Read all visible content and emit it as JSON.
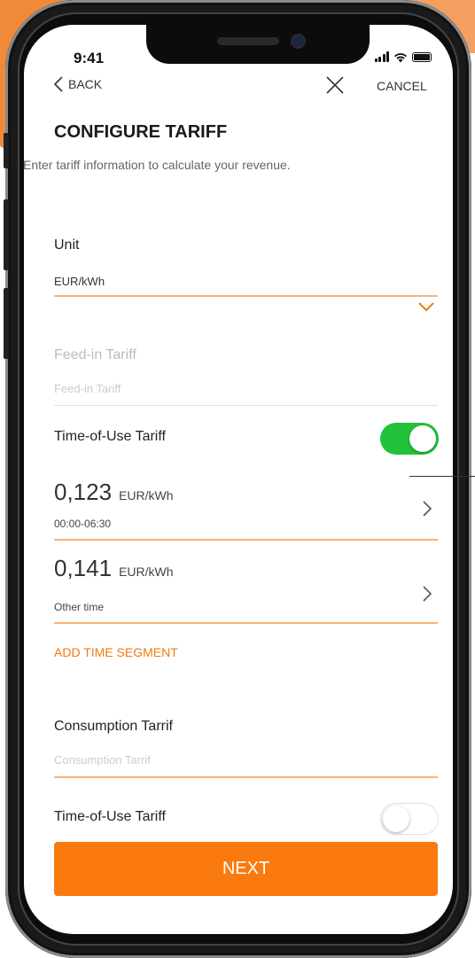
{
  "status_bar": {
    "time": "9:41"
  },
  "nav": {
    "back_label": "BACK",
    "cancel_label": "CANCEL"
  },
  "header": {
    "title": "CONFIGURE TARIFF",
    "subtitle": "Enter tariff information to calculate your revenue."
  },
  "unit_field": {
    "label": "Unit",
    "value": "EUR/kWh"
  },
  "feed_in_field": {
    "label": "Feed-in Tariff",
    "placeholder": "Feed-in Tariff"
  },
  "feed_in_tou": {
    "label": "Time-of-Use Tariff",
    "enabled": true
  },
  "time_segments": [
    {
      "price": "0,123",
      "unit": "EUR/kWh",
      "period": "00:00-06:30"
    },
    {
      "price": "0,141",
      "unit": "EUR/kWh",
      "period": "Other time"
    }
  ],
  "add_segment_label": "ADD TIME SEGMENT",
  "consumption_field": {
    "label": "Consumption Tarrif",
    "placeholder": "Consumption Tarrif"
  },
  "consumption_tou": {
    "label": "Time-of-Use Tariff",
    "enabled": false
  },
  "next_button_label": "NEXT",
  "colors": {
    "accent": "#fa7a0f",
    "toggle_on": "#22c23a",
    "underline": "#f7b37a"
  },
  "icons": [
    "chevron-left-icon",
    "close-icon",
    "chevron-down-icon",
    "chevron-right-icon",
    "signal-icon",
    "wifi-icon",
    "battery-icon"
  ]
}
